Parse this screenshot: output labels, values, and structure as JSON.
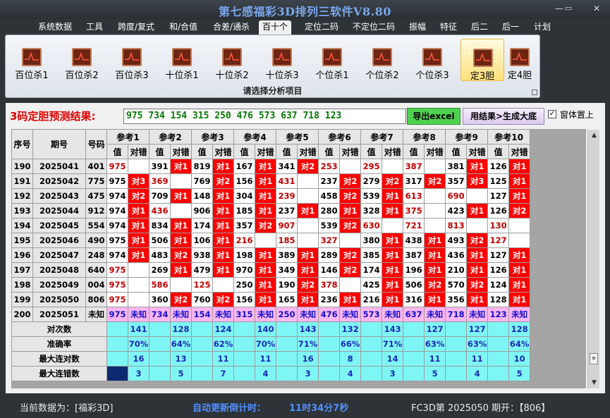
{
  "window": {
    "title": "第七感福彩3D排列三软件V8.80"
  },
  "menu": [
    "系统数据",
    "工具",
    "跨度/复式",
    "和/合值",
    "合差/通杀",
    "百十个",
    "定位二码",
    "不定位二码",
    "振幅",
    "特征",
    "后二",
    "后一",
    "计划"
  ],
  "menu_active_index": 5,
  "ribbon": {
    "buttons": [
      "百位杀1",
      "百位杀2",
      "百位杀3",
      "十位杀1",
      "十位杀2",
      "十位杀3",
      "个位杀1",
      "个位杀2",
      "个位杀3",
      "定3胆",
      "定4胆"
    ],
    "selected_index": 9,
    "caption": "请选择分析项目"
  },
  "prediction": {
    "label": "3码定胆预测结果:",
    "value": "975 734 154 315 250 476 573 637 718 123",
    "export_label": "导出excel",
    "generate_label": "用结果>生成大底",
    "pin_label": "窗体置上",
    "pin_checked": "✓"
  },
  "table": {
    "head": {
      "seq": "序号",
      "period": "期号",
      "num": "号码"
    },
    "refs": [
      "参考1",
      "参考2",
      "参考3",
      "参考4",
      "参考5",
      "参考6",
      "参考7",
      "参考8",
      "参考9",
      "参考10"
    ],
    "sub": [
      "值",
      "对错"
    ],
    "rows": [
      {
        "seq": "190",
        "period": "2025041",
        "num": "401",
        "cells": [
          [
            "975",
            "",
            "r"
          ],
          [
            "391",
            "对1",
            ""
          ],
          [
            "819",
            "对1",
            ""
          ],
          [
            "167",
            "对1",
            ""
          ],
          [
            "341",
            "对2",
            ""
          ],
          [
            "253",
            "",
            "r"
          ],
          [
            "295",
            "",
            "r"
          ],
          [
            "387",
            "",
            "r"
          ],
          [
            "381",
            "对1",
            ""
          ],
          [
            "126",
            "对1",
            ""
          ]
        ]
      },
      {
        "seq": "191",
        "period": "2025042",
        "num": "775",
        "cells": [
          [
            "975",
            "对3",
            ""
          ],
          [
            "369",
            "",
            "r"
          ],
          [
            "769",
            "对2",
            ""
          ],
          [
            "156",
            "对1",
            ""
          ],
          [
            "431",
            "",
            "r"
          ],
          [
            "237",
            "对2",
            ""
          ],
          [
            "279",
            "对2",
            ""
          ],
          [
            "317",
            "对2",
            ""
          ],
          [
            "357",
            "对3",
            ""
          ],
          [
            "125",
            "对1",
            ""
          ]
        ]
      },
      {
        "seq": "192",
        "period": "2025043",
        "num": "475",
        "cells": [
          [
            "974",
            "对2",
            ""
          ],
          [
            "709",
            "对1",
            ""
          ],
          [
            "148",
            "对1",
            ""
          ],
          [
            "304",
            "对1",
            ""
          ],
          [
            "239",
            "",
            "r"
          ],
          [
            "458",
            "对2",
            ""
          ],
          [
            "539",
            "对1",
            ""
          ],
          [
            "613",
            "",
            "r"
          ],
          [
            "690",
            "",
            "r"
          ],
          [
            "127",
            "对1",
            ""
          ]
        ]
      },
      {
        "seq": "193",
        "period": "2025044",
        "num": "912",
        "cells": [
          [
            "974",
            "对1",
            ""
          ],
          [
            "436",
            "",
            "r"
          ],
          [
            "906",
            "对1",
            ""
          ],
          [
            "185",
            "对1",
            ""
          ],
          [
            "237",
            "对1",
            ""
          ],
          [
            "280",
            "对1",
            ""
          ],
          [
            "328",
            "对1",
            ""
          ],
          [
            "375",
            "",
            "r"
          ],
          [
            "423",
            "对1",
            ""
          ],
          [
            "126",
            "对2",
            ""
          ]
        ]
      },
      {
        "seq": "194",
        "period": "2025045",
        "num": "554",
        "cells": [
          [
            "974",
            "对1",
            ""
          ],
          [
            "834",
            "对1",
            ""
          ],
          [
            "174",
            "对1",
            ""
          ],
          [
            "357",
            "对2",
            ""
          ],
          [
            "907",
            "",
            "r"
          ],
          [
            "539",
            "对2",
            ""
          ],
          [
            "630",
            "",
            "r"
          ],
          [
            "721",
            "",
            "r"
          ],
          [
            "813",
            "",
            "r"
          ],
          [
            "130",
            "",
            "r"
          ]
        ]
      },
      {
        "seq": "195",
        "period": "2025046",
        "num": "490",
        "cells": [
          [
            "975",
            "对1",
            ""
          ],
          [
            "506",
            "对1",
            ""
          ],
          [
            "106",
            "对1",
            ""
          ],
          [
            "216",
            "",
            "r"
          ],
          [
            "185",
            "",
            "r"
          ],
          [
            "327",
            "",
            "r"
          ],
          [
            "380",
            "对1",
            ""
          ],
          [
            "438",
            "对1",
            ""
          ],
          [
            "493",
            "对2",
            ""
          ],
          [
            "127",
            "",
            "r"
          ]
        ]
      },
      {
        "seq": "196",
        "period": "2025047",
        "num": "248",
        "cells": [
          [
            "974",
            "对1",
            ""
          ],
          [
            "483",
            "对2",
            ""
          ],
          [
            "938",
            "对1",
            ""
          ],
          [
            "198",
            "对1",
            ""
          ],
          [
            "389",
            "对1",
            ""
          ],
          [
            "289",
            "对2",
            ""
          ],
          [
            "385",
            "对1",
            ""
          ],
          [
            "387",
            "对1",
            ""
          ],
          [
            "436",
            "对1",
            ""
          ],
          [
            "127",
            "对1",
            ""
          ]
        ]
      },
      {
        "seq": "197",
        "period": "2025048",
        "num": "640",
        "cells": [
          [
            "975",
            "",
            "r"
          ],
          [
            "269",
            "对1",
            ""
          ],
          [
            "479",
            "对1",
            ""
          ],
          [
            "970",
            "对1",
            ""
          ],
          [
            "349",
            "对1",
            ""
          ],
          [
            "146",
            "对2",
            ""
          ],
          [
            "174",
            "对1",
            ""
          ],
          [
            "196",
            "对1",
            ""
          ],
          [
            "210",
            "对1",
            ""
          ],
          [
            "126",
            "对1",
            ""
          ]
        ]
      },
      {
        "seq": "198",
        "period": "2025049",
        "num": "004",
        "cells": [
          [
            "975",
            "",
            "r"
          ],
          [
            "586",
            "",
            "r"
          ],
          [
            "125",
            "",
            "r"
          ],
          [
            "250",
            "对1",
            ""
          ],
          [
            "190",
            "对2",
            ""
          ],
          [
            "378",
            "",
            "r"
          ],
          [
            "425",
            "对1",
            ""
          ],
          [
            "506",
            "对2",
            ""
          ],
          [
            "570",
            "对2",
            ""
          ],
          [
            "124",
            "对1",
            ""
          ]
        ]
      },
      {
        "seq": "199",
        "period": "2025050",
        "num": "806",
        "cells": [
          [
            "975",
            "",
            "r"
          ],
          [
            "360",
            "对2",
            ""
          ],
          [
            "760",
            "对2",
            ""
          ],
          [
            "156",
            "对1",
            ""
          ],
          [
            "165",
            "对1",
            ""
          ],
          [
            "236",
            "对1",
            ""
          ],
          [
            "216",
            "对1",
            ""
          ],
          [
            "316",
            "对1",
            ""
          ],
          [
            "356",
            "对1",
            ""
          ],
          [
            "128",
            "对1",
            ""
          ]
        ]
      },
      {
        "seq": "200",
        "period": "2025051",
        "num": "未知",
        "cells": [
          [
            "975",
            "未知",
            "p"
          ],
          [
            "734",
            "未知",
            "p"
          ],
          [
            "154",
            "未知",
            "p"
          ],
          [
            "315",
            "未知",
            "p"
          ],
          [
            "250",
            "未知",
            "p"
          ],
          [
            "476",
            "未知",
            "p"
          ],
          [
            "573",
            "未知",
            "p"
          ],
          [
            "637",
            "未知",
            "p"
          ],
          [
            "718",
            "未知",
            "p"
          ],
          [
            "123",
            "未知",
            "p"
          ]
        ]
      }
    ],
    "stats": [
      {
        "label": "对次数",
        "values": [
          "141",
          "128",
          "124",
          "140",
          "143",
          "132",
          "143",
          "127",
          "127",
          "128"
        ]
      },
      {
        "label": "准确率",
        "values": [
          "70%",
          "64%",
          "62%",
          "70%",
          "71%",
          "66%",
          "71%",
          "63%",
          "63%",
          "64%"
        ]
      },
      {
        "label": "最大连对数",
        "values": [
          "16",
          "13",
          "11",
          "11",
          "16",
          "8",
          "14",
          "11",
          "11",
          "10"
        ]
      },
      {
        "label": "最大连错数",
        "values": [
          "3",
          "5",
          "7",
          "4",
          "3",
          "4",
          "3",
          "5",
          "4",
          "5"
        ]
      }
    ]
  },
  "status": {
    "current_data": "当前数据为：[福彩3D]",
    "countdown_label": "自动更新倒计时：",
    "countdown_value": "11时34分7秒",
    "issue_info": "FC3D第 2025050 期开：【806】"
  },
  "colors": {
    "miss_text": "#c00000",
    "hit_cell": "#ff0000",
    "pending_row": "#ffb6f2",
    "stats_row": "#7ff6f6",
    "title_text": "#7aa8ee",
    "status_text_yellow": "#f2e600",
    "status_text_blue": "#4f90ff"
  }
}
